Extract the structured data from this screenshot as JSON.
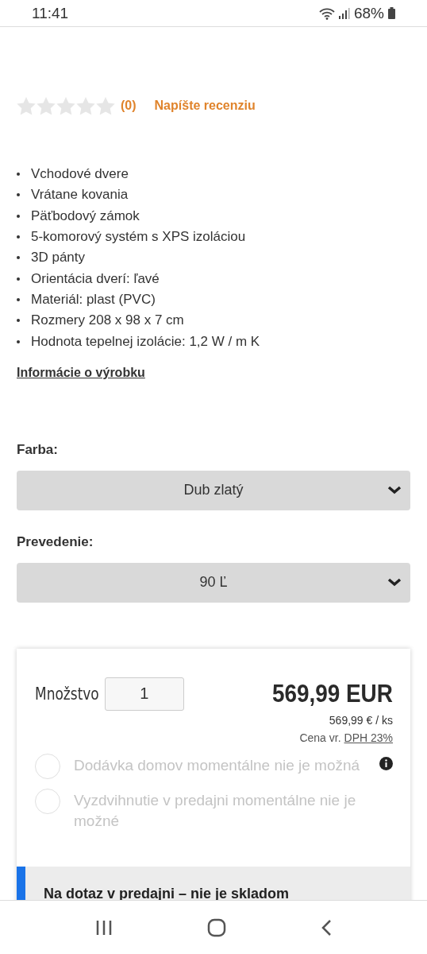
{
  "status_bar": {
    "time": "11:41",
    "battery": "68%"
  },
  "rating": {
    "stars": 0,
    "count": "(0)",
    "write_review": "Napíšte recenziu"
  },
  "features": [
    "Vchodové dvere",
    "Vrátane kovania",
    "Päťbodový zámok",
    "5-komorový systém s XPS izoláciou",
    "3D pánty",
    "Orientácia dverí: ľavé",
    "Materiál: plast (PVC)",
    "Rozmery 208 x 98 x 7 cm",
    "Hodnota tepelnej izolácie: 1,2 W / m K"
  ],
  "product_info_link": "Informácie o výrobku",
  "options": [
    {
      "label": "Farba:",
      "value": "Dub zlatý"
    },
    {
      "label": "Prevedenie:",
      "value": "90 Ľ"
    }
  ],
  "purchase": {
    "quantity_label": "Množstvo",
    "quantity": "1",
    "price": "569,99 EUR",
    "unit_price": "569,99 € / ks",
    "vat_prefix": "Cena vr.",
    "vat_link": "DPH 23%",
    "delivery": [
      {
        "label": "Dodávka domov momentálne nie je možná",
        "selected": false,
        "disabled": true,
        "info": true
      },
      {
        "label": "Vyzdvihnutie v predajni momentálne nie je možné",
        "selected": false,
        "disabled": true,
        "info": false
      }
    ],
    "availability": {
      "title": "Na dotaz v predajni – nie je skladom"
    }
  }
}
